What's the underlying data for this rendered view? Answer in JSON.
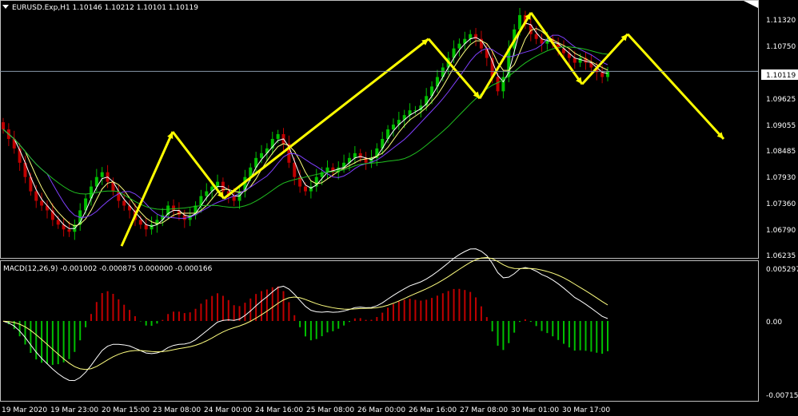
{
  "window": {
    "symbol_line": "EURUSD.Exp,H1  1.10146 1.10212 1.10101 1.10119",
    "menu_icon": "triangle-down-icon"
  },
  "colors": {
    "background": "#000000",
    "bull": "#00c000",
    "bear": "#c00000",
    "ma_fast": "#ffffff",
    "ma_mid": "#ffff80",
    "ma_slow": "#8040ff",
    "ma_long": "#20c020",
    "arrows": "#ffff00",
    "grid_frame": "#c0c0c0",
    "price_line": "#8899aa"
  },
  "price_axis": {
    "labels": [
      "1.11320",
      "1.10750",
      "1.10119",
      "1.09625",
      "1.09055",
      "1.08485",
      "1.07930",
      "1.07360",
      "1.06790",
      "1.06235"
    ],
    "current": "1.10119"
  },
  "macd_panel": {
    "title": "MACD(12,26,9) -0.001002 -0.000875 0.000000 -0.000166",
    "labels": [
      "0.005297",
      "0.00",
      "-0.007157"
    ]
  },
  "time_axis": {
    "labels": [
      "19 Mar 2020",
      "19 Mar 23:00",
      "20 Mar 15:00",
      "23 Mar 08:00",
      "24 Mar 00:00",
      "24 Mar 16:00",
      "25 Mar 08:00",
      "26 Mar 00:00",
      "26 Mar 16:00",
      "27 Mar 08:00",
      "30 Mar 01:00",
      "30 Mar 17:00"
    ]
  },
  "chart_data": {
    "type": "candlestick",
    "symbol": "EURUSD.Exp",
    "timeframe": "H1",
    "last_ohlc": {
      "open": 1.10146,
      "high": 1.10212,
      "low": 1.10101,
      "close": 1.10119
    },
    "ylim": [
      1.06235,
      1.1155
    ],
    "x_tick_labels": [
      "19 Mar 2020",
      "19 Mar 23:00",
      "20 Mar 15:00",
      "23 Mar 08:00",
      "24 Mar 00:00",
      "24 Mar 16:00",
      "25 Mar 08:00",
      "26 Mar 00:00",
      "26 Mar 16:00",
      "27 Mar 08:00",
      "30 Mar 01:00",
      "30 Mar 17:00"
    ],
    "y_tick_labels": [
      1.1132,
      1.1075,
      1.09625,
      1.09055,
      1.08485,
      1.0793,
      1.0736,
      1.0679,
      1.06235
    ],
    "price_path_close": [
      1.089,
      1.087,
      1.085,
      1.082,
      1.079,
      1.076,
      1.074,
      1.073,
      1.072,
      1.07,
      1.069,
      1.068,
      1.0675,
      1.069,
      1.072,
      1.0745,
      1.077,
      1.079,
      1.08,
      1.078,
      1.076,
      1.074,
      1.073,
      1.072,
      1.07,
      1.069,
      1.068,
      1.069,
      1.07,
      1.071,
      1.073,
      1.072,
      1.071,
      1.07,
      1.071,
      1.073,
      1.075,
      1.076,
      1.077,
      1.078,
      1.076,
      1.075,
      1.074,
      1.076,
      1.079,
      1.081,
      1.083,
      1.084,
      1.085,
      1.087,
      1.088,
      1.086,
      1.082,
      1.079,
      1.077,
      1.076,
      1.077,
      1.079,
      1.08,
      1.081,
      1.08,
      1.081,
      1.082,
      1.083,
      1.084,
      1.083,
      1.082,
      1.083,
      1.085,
      1.087,
      1.089,
      1.09,
      1.091,
      1.092,
      1.093,
      1.093,
      1.094,
      1.096,
      1.098,
      1.1,
      1.102,
      1.104,
      1.106,
      1.107,
      1.108,
      1.109,
      1.108,
      1.106,
      1.104,
      1.1,
      1.097,
      1.1,
      1.106,
      1.11,
      1.113,
      1.111,
      1.109,
      1.108,
      1.107,
      1.108,
      1.107,
      1.106,
      1.105,
      1.104,
      1.103,
      1.104,
      1.103,
      1.102,
      1.101,
      1.1,
      1.1012
    ],
    "arrows_drawn": [
      {
        "from": [
          "20 Mar 15:00",
          1.0645
        ],
        "to": [
          "23 Mar 08:00",
          1.0885
        ]
      },
      {
        "from": [
          "23 Mar 08:00",
          1.0885
        ],
        "to": [
          "24 Mar 00:00",
          1.0745
        ]
      },
      {
        "from": [
          "24 Mar 00:00",
          1.0745
        ],
        "to": [
          "26 Mar 16:00",
          1.108
        ]
      },
      {
        "from": [
          "26 Mar 16:00",
          1.108
        ],
        "to": [
          "27 Mar 08:00",
          1.0955
        ]
      },
      {
        "from": [
          "27 Mar 08:00",
          1.0955
        ],
        "to": [
          "30 Mar 01:00",
          1.1135
        ]
      },
      {
        "from": [
          "30 Mar 01:00",
          1.1135
        ],
        "to": [
          "30 Mar 17:00",
          1.0985
        ]
      },
      {
        "from": [
          "30 Mar 17:00",
          1.0985
        ],
        "to": [
          "after 30 Mar 17:00",
          1.109
        ]
      },
      {
        "from": [
          "after 30 Mar 17:00",
          1.109
        ],
        "to": [
          "after 30 Mar 17:00",
          1.087
        ]
      }
    ],
    "macd": {
      "params": "12,26,9",
      "values": {
        "macd": -0.001002,
        "signal": -0.000875,
        "hist": 0.0,
        "extra": -0.000166
      },
      "ylim": [
        -0.007157,
        0.005297
      ]
    }
  }
}
